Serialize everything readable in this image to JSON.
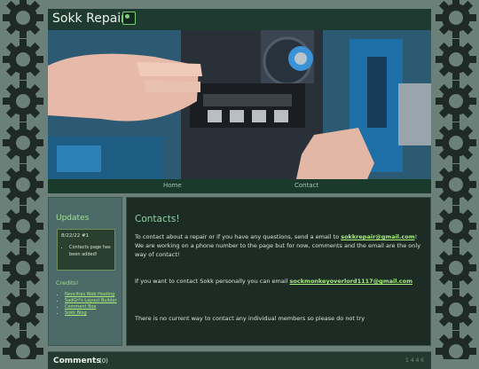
{
  "site": {
    "title": "Sokk Repairs!",
    "logo_icon": "sokk-logo-icon"
  },
  "nav": {
    "items": [
      {
        "label": "Home"
      },
      {
        "label": "Contact"
      }
    ]
  },
  "sidebar": {
    "updates_title": "Updates",
    "update": {
      "date": "8/22/22 #1",
      "items": [
        "Contacts page has been added!"
      ]
    },
    "credits_title": "Credits!",
    "credits": [
      {
        "label": "Neocities Web Hosting"
      },
      {
        "label": "SadGrl's Layout Builder"
      },
      {
        "label": "Comment Box"
      },
      {
        "label": "Sokk Blog"
      }
    ]
  },
  "main": {
    "heading": "Contacts!",
    "p1_before": "To contact about a repair or if you have any questions, send a email to ",
    "p1_email": "sokkrepair@gmail.com",
    "p1_after": "! We are working on a phone number to the page but for now, comments and the email are the only way of contact!",
    "p2_before": "If you want to contact Sokk personally you can email ",
    "p2_email": "sockmonkeyoverlord1117@gmail.com",
    "p3": "There is no current way to contact any individual members so please do not try"
  },
  "comments": {
    "label": "Comments",
    "count": "(0)",
    "right_text": "1 4 4 6"
  },
  "colors": {
    "background": "#6b8078",
    "gear": "#1f2a26",
    "header": "#1f3a30",
    "panel": "#1c2c25",
    "link": "#a8f07a",
    "heading": "#8fd0a8"
  }
}
